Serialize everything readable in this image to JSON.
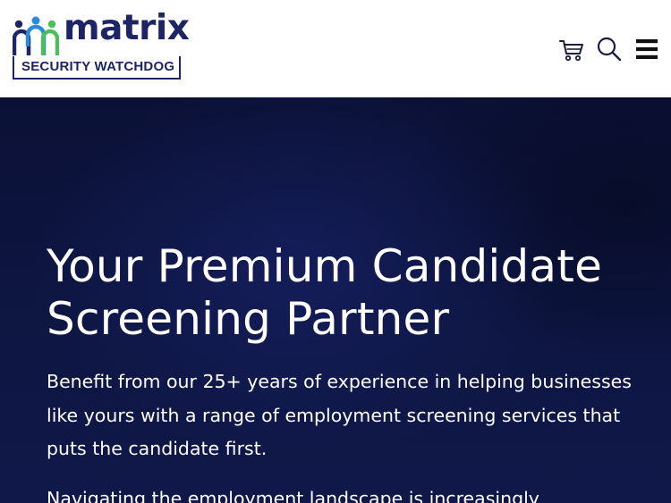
{
  "header": {
    "logo": {
      "wordmark": "matrix",
      "tagline": "SECURITY WATCHDOG",
      "colors": {
        "navy": "#1e2566",
        "blue": "#2a8bd6",
        "green": "#4dbf5a"
      }
    },
    "icons": [
      "cart-icon",
      "search-icon",
      "menu-icon"
    ]
  },
  "hero": {
    "title": "Your Premium Candidate Screening Partner",
    "paragraph_1": "Benefit from our 25+ years of experience in helping businesses like yours with a range of employment screening services that puts the candidate first.",
    "paragraph_2": "Navigating the employment landscape is increasingly",
    "background_color": "#0d1540",
    "text_color": "#ffffff"
  }
}
